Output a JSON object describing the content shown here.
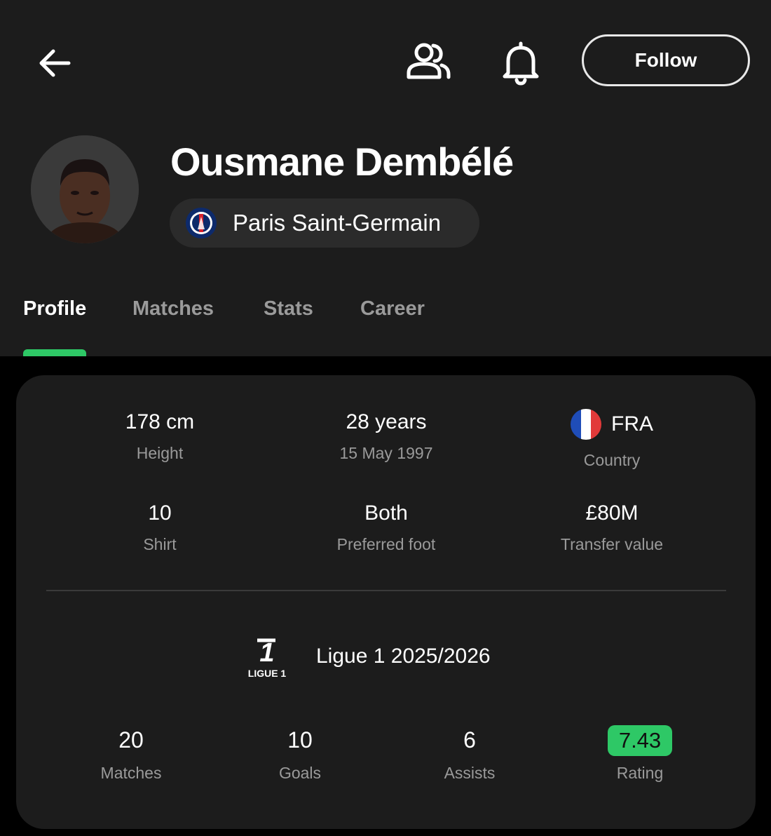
{
  "player": {
    "name": "Ousmane Dembélé",
    "club": "Paris Saint-Germain"
  },
  "toolbar": {
    "follow_label": "Follow"
  },
  "tabs": [
    {
      "label": "Profile",
      "active": true
    },
    {
      "label": "Matches",
      "active": false
    },
    {
      "label": "Stats",
      "active": false
    },
    {
      "label": "Career",
      "active": false
    }
  ],
  "profile": {
    "height": {
      "value": "178 cm",
      "label": "Height"
    },
    "age": {
      "value": "28 years",
      "label": "15 May 1997"
    },
    "country": {
      "value": "FRA",
      "label": "Country"
    },
    "shirt": {
      "value": "10",
      "label": "Shirt"
    },
    "foot": {
      "value": "Both",
      "label": "Preferred foot"
    },
    "transfer": {
      "value": "£80M",
      "label": "Transfer value"
    }
  },
  "season": {
    "logo_text": "LIGUE 1",
    "title": "Ligue 1 2025/2026",
    "stats": [
      {
        "value": "20",
        "label": "Matches"
      },
      {
        "value": "10",
        "label": "Goals"
      },
      {
        "value": "6",
        "label": "Assists"
      },
      {
        "value": "7.43",
        "label": "Rating"
      }
    ]
  },
  "colors": {
    "accent": "#2ec866",
    "header_bg": "#1c1c1c",
    "card_bg": "#1c1c1c",
    "page_bg": "#000000",
    "muted_text": "#9a9a9a"
  },
  "icons": [
    "back-arrow-icon",
    "people-icon",
    "bell-icon",
    "psg-crest-icon",
    "france-flag-icon",
    "ligue1-logo-icon"
  ]
}
